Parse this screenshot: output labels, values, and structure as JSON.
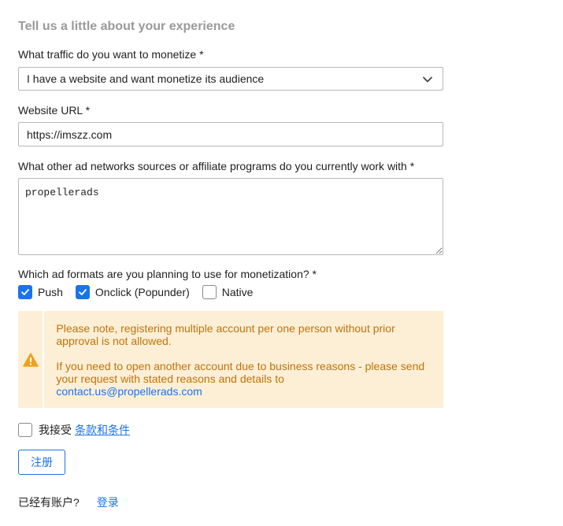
{
  "form": {
    "heading": "Tell us a little about your experience",
    "traffic": {
      "label": "What traffic do you want to monetize *",
      "value": "I have a website and want monetize its audience"
    },
    "website_url": {
      "label": "Website URL *",
      "value": "https://imszz.com"
    },
    "networks": {
      "label": "What other ad networks sources or affiliate programs do you currently work with *",
      "value": "propellerads"
    },
    "formats": {
      "label": "Which ad formats are you planning to use for monetization? *",
      "options": [
        {
          "label": "Push",
          "checked": true
        },
        {
          "label": "Onclick (Popunder)",
          "checked": true
        },
        {
          "label": "Native",
          "checked": false
        }
      ]
    },
    "notice": {
      "line1": "Please note, registering multiple account per one person without prior approval is not allowed.",
      "line2": "If you need to open another account due to business reasons - please send your request with stated reasons and details to",
      "email": "contact.us@propellerads.com"
    },
    "agree": {
      "text": "我接受",
      "link": "条款和条件",
      "checked": false
    },
    "register_label": "注册",
    "login": {
      "prompt": "已经有账户?",
      "link": "登录"
    }
  },
  "colors": {
    "accent": "#1a73e8",
    "notice_bg": "#fdefd6",
    "notice_text": "#c0730a",
    "warning_icon": "#f0a020"
  }
}
